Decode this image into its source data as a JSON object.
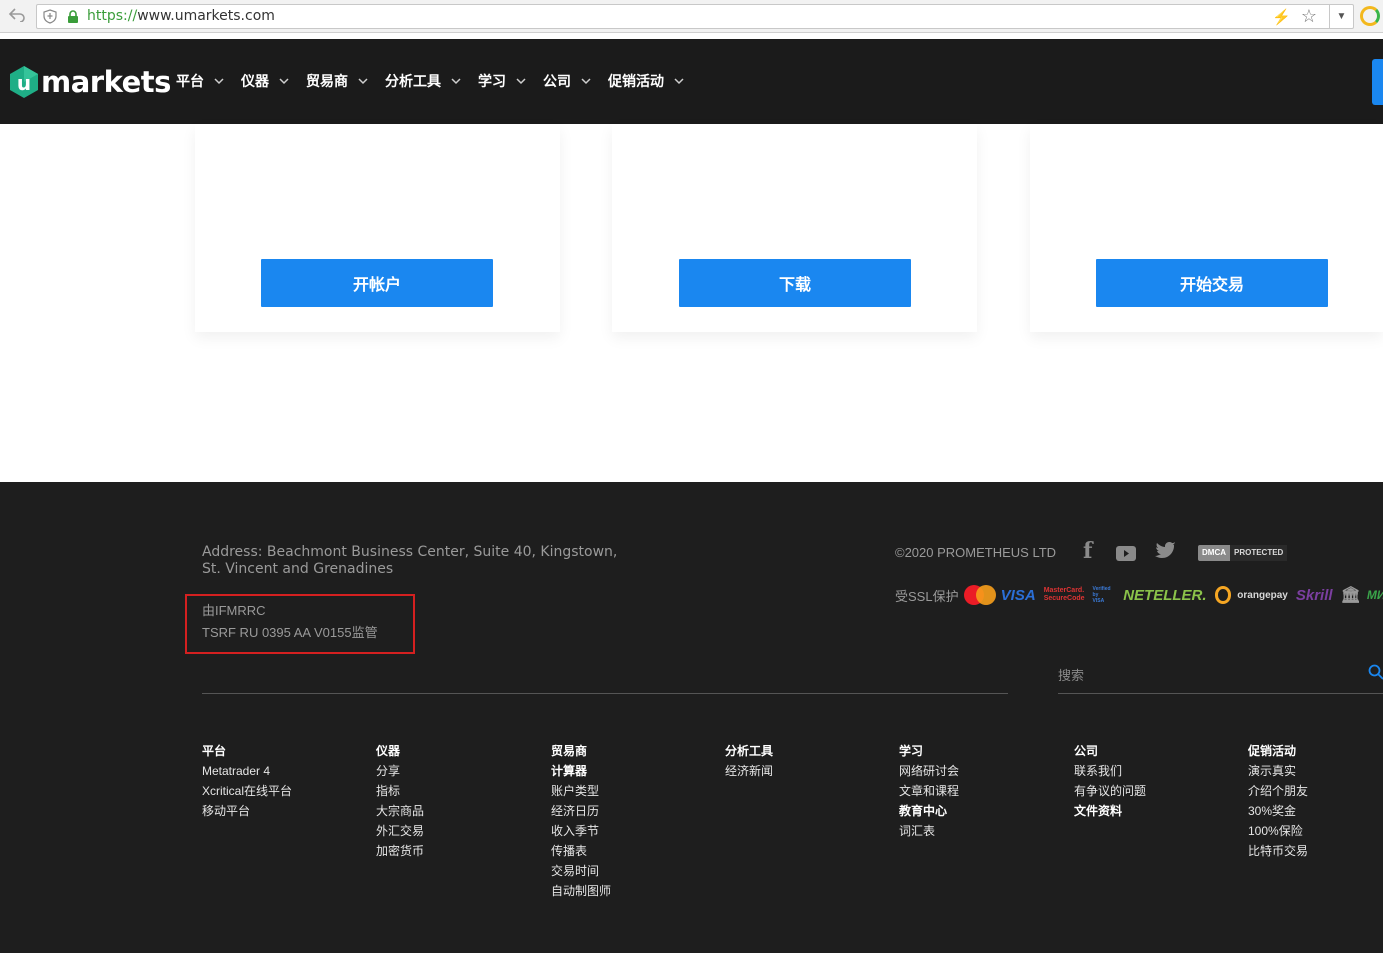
{
  "browser": {
    "url_scheme": "https://",
    "url_rest": "www.umarkets.com"
  },
  "header": {
    "logo_text": "markets",
    "logo_letter": "u",
    "nav": [
      {
        "label": "平台"
      },
      {
        "label": "仪器"
      },
      {
        "label": "贸易商"
      },
      {
        "label": "分析工具"
      },
      {
        "label": "学习"
      },
      {
        "label": "公司"
      },
      {
        "label": "促销活动"
      }
    ]
  },
  "cards": [
    {
      "button_label": "开帐户"
    },
    {
      "button_label": "下载"
    },
    {
      "button_label": "开始交易"
    }
  ],
  "footer": {
    "address": "Address: Beachmont Business Center, Suite 40, Kingstown, St. Vincent and Grenadines",
    "regulation_line1": "由IFMRRC",
    "regulation_line2": "TSRF RU 0395 AA V0155监管",
    "copyright": "©2020 PROMETHEUS LTD",
    "dmca_left": "DMCA",
    "dmca_right": "PROTECTED",
    "ssl_label": "受SSL保护",
    "payments": {
      "visa": "VISA",
      "mc_securecode_1": "MasterCard.",
      "mc_securecode_2": "SecureCode",
      "vbv_1": "Verified by",
      "vbv_2": "VISA",
      "neteller": "NETELLER.",
      "orangepay": "orangepay",
      "skrill": "Skrill",
      "mir": "МИР"
    },
    "search_placeholder": "搜索",
    "columns": [
      {
        "heading": "平台",
        "links": [
          {
            "label": "Metatrader 4"
          },
          {
            "label": "Xcritical在线平台"
          },
          {
            "label": "移动平台"
          }
        ]
      },
      {
        "heading": "仪器",
        "links": [
          {
            "label": "分享"
          },
          {
            "label": "指标"
          },
          {
            "label": "大宗商品"
          },
          {
            "label": "外汇交易"
          },
          {
            "label": "加密货币"
          }
        ]
      },
      {
        "heading": "贸易商",
        "links": [
          {
            "label": "计算器",
            "bold": true
          },
          {
            "label": "账户类型"
          },
          {
            "label": "经济日历"
          },
          {
            "label": "收入季节"
          },
          {
            "label": "传播表"
          },
          {
            "label": "交易时间"
          },
          {
            "label": "自动制图师"
          }
        ]
      },
      {
        "heading": "分析工具",
        "links": [
          {
            "label": "经济新闻"
          }
        ]
      },
      {
        "heading": "学习",
        "links": [
          {
            "label": "网络研讨会"
          },
          {
            "label": "文章和课程"
          },
          {
            "label": "教育中心",
            "bold": true
          },
          {
            "label": "词汇表"
          }
        ]
      },
      {
        "heading": "公司",
        "links": [
          {
            "label": "联系我们"
          },
          {
            "label": "有争议的问题"
          },
          {
            "label": "文件资料",
            "bold": true
          }
        ]
      },
      {
        "heading": "促销活动",
        "links": [
          {
            "label": "演示真实"
          },
          {
            "label": "介绍个朋友"
          },
          {
            "label": "30%奖金"
          },
          {
            "label": "100%保险"
          },
          {
            "label": "比特币交易"
          }
        ]
      }
    ]
  }
}
